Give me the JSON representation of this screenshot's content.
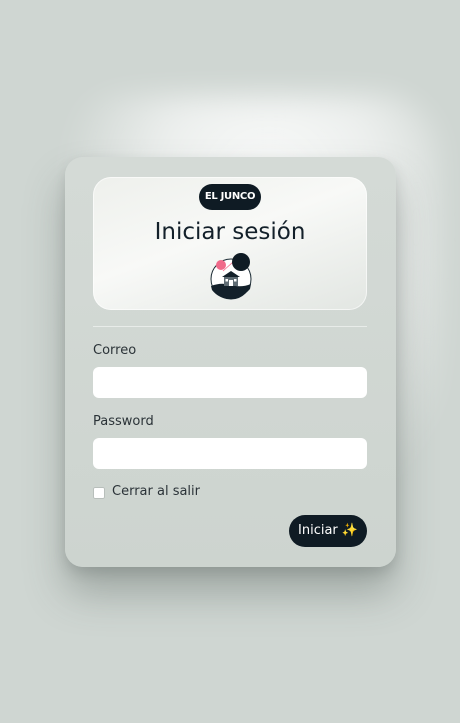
{
  "brand": {
    "badge": "EL JUNCO"
  },
  "login": {
    "title": "Iniciar sesión",
    "email_label": "Correo",
    "email_value": "",
    "password_label": "Password",
    "password_value": "",
    "remember_label": "Cerrar al salir",
    "remember_checked": false,
    "submit_label": "Iniciar",
    "submit_icon": "✨"
  },
  "colors": {
    "background": "#cfd6d2",
    "card": "#d1d8d4",
    "accent_dark": "#0f1b24",
    "logo_pink": "#f06a8a"
  },
  "icons": {
    "logo": "house-logo-icon",
    "submit": "sparkles-icon"
  }
}
